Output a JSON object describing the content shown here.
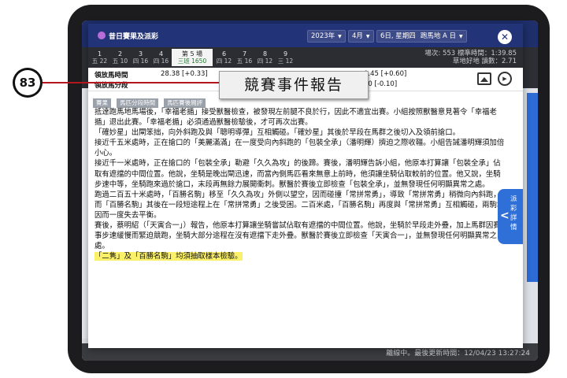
{
  "header": {
    "title": "昔日賽果及派彩",
    "year": "2023年",
    "month": "4月",
    "day": "6日, 星期四",
    "venue": "跑馬地 A 日"
  },
  "tabs": [
    {
      "race": "1",
      "sub": "五 22"
    },
    {
      "race": "2",
      "sub": "五 10"
    },
    {
      "race": "3",
      "sub": "四 16"
    },
    {
      "race": "4",
      "sub": "四 16"
    },
    {
      "race": "第 5 場",
      "sub": "三班 1650",
      "active": true
    },
    {
      "race": "6",
      "sub": "四 12"
    },
    {
      "race": "7",
      "sub": "五 16"
    },
    {
      "race": "8",
      "sub": "四 12"
    },
    {
      "race": "9",
      "sub": "三 12"
    }
  ],
  "tab_stats": {
    "line1": "場次: 553  標準時間：1:39.85",
    "line2": "草地好地  讀數：2.71"
  },
  "info": {
    "row1_label": "領放馬時間",
    "row1_value": "28.38 [+0.33]",
    "row1_right": "0.45 [+0.60]",
    "row2_label": "領放馬分段",
    "row2_right": "60 [-0.10]"
  },
  "subtabs": [
    "賽果",
    "馬匹分段時間",
    "馬匹賽後閱評"
  ],
  "report": [
    "抵達跑馬地馬場後，「幸福老揗」接受獸醫檢查，被發現左前腿不良於行，因此不適宜出賽。小組按照獸醫意見著令「幸福老揗」退出此賽。「幸福老揗」必須通過獸醫檢驗後，才可再次出賽。",
    "「確妙星」出閘笨拙，向外斜跑及與「聰明導彈」互相觸碰。「確妙星」其後於早段在馬群之後切入及領前搶口。",
    "接近千五米處時，正在搶口的「美麗滿滿」在一度受向內斜跑的「包裝全承」（潘明輝）擠迫之際收韁。小組告誡潘明輝須加倍小心。",
    "接近千一米處時，正在搶口的「包裝全承」勒避「久久為攻」的後蹄。賽後，潘明輝告訴小組，他原本打算讓「包裝全承」佔取有遮擋的中間位置。他說，坐騎是晚出閘迅速，而當內側馬匹看來無意上前時，他須讓坐騎佔取較前的位置。他又說，坐騎步速中等，坐騎跑來過於搶口，末段再無餘力展開衝刺。獸醫於賽後立即檢查「包裝全承」，並無發現任何明顯異常之處。",
    "跑過二百五十米處時，「百勝名駒」移至「久久為攻」外側以望空，因而碰撞「常拼常勇」，導致「常拼常勇」稍微向內斜跑，而「百勝名駒」其後在一段短途程上在「常拼常勇」之後受困。二百米處，「百勝名駒」再度與「常拼常勇」互相觸碰，兩駒均因而一度失去平衡。",
    "賽後，蔡明紹（「天寅合一」）報告，他原本打算讓坐騎嘗試佔取有遮擋的中間位置。他說，坐騎於早段走外疊，加上馬群因賽事步速緩慢而緊迫競跑，坐騎大部分途程在沒有遮擋下走外疊。獸醫於賽後立即檢查「天寅合一」，並無發現任何明顯異常之處。"
  ],
  "report_highlight": "「二隽」及「百勝名駒」均須抽取樣本檢驗。",
  "callout": {
    "number": "83",
    "label": "競賽事件報告"
  },
  "side_tab": {
    "label": "派彩詳情"
  },
  "footer_text": "離線中。最後更新時間：12/04/23 13:27:24",
  "colors": {
    "header": "#223377",
    "accent": "#2f6fd8",
    "highlight": "#fbf06a",
    "leader": "#b3171d"
  }
}
